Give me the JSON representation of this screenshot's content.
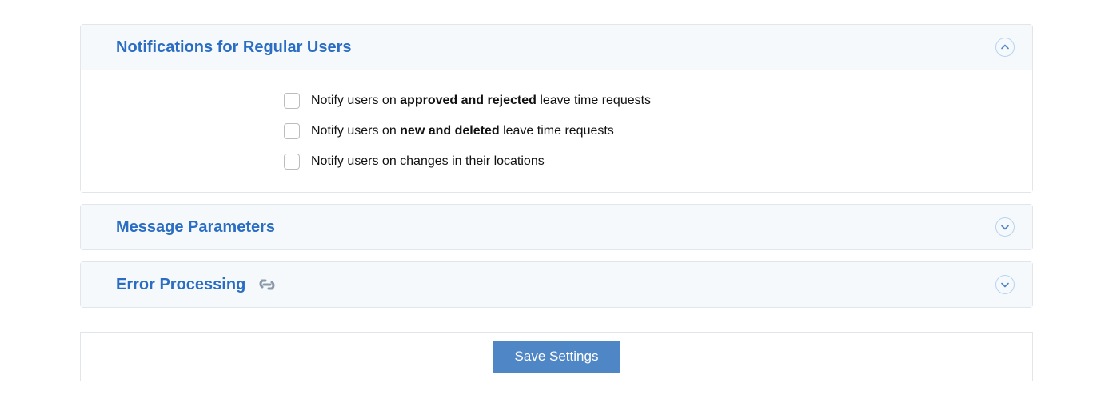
{
  "panels": {
    "notifications": {
      "title": "Notifications for Regular Users",
      "items": [
        {
          "pre": "Notify users on ",
          "bold": "approved and rejected",
          "post": " leave time requests"
        },
        {
          "pre": "Notify users on ",
          "bold": "new and deleted",
          "post": " leave time requests"
        },
        {
          "pre": "Notify users on changes in their locations",
          "bold": "",
          "post": ""
        }
      ]
    },
    "messageParams": {
      "title": "Message Parameters"
    },
    "errorProcessing": {
      "title": "Error Processing"
    }
  },
  "footer": {
    "save_label": "Save Settings"
  }
}
